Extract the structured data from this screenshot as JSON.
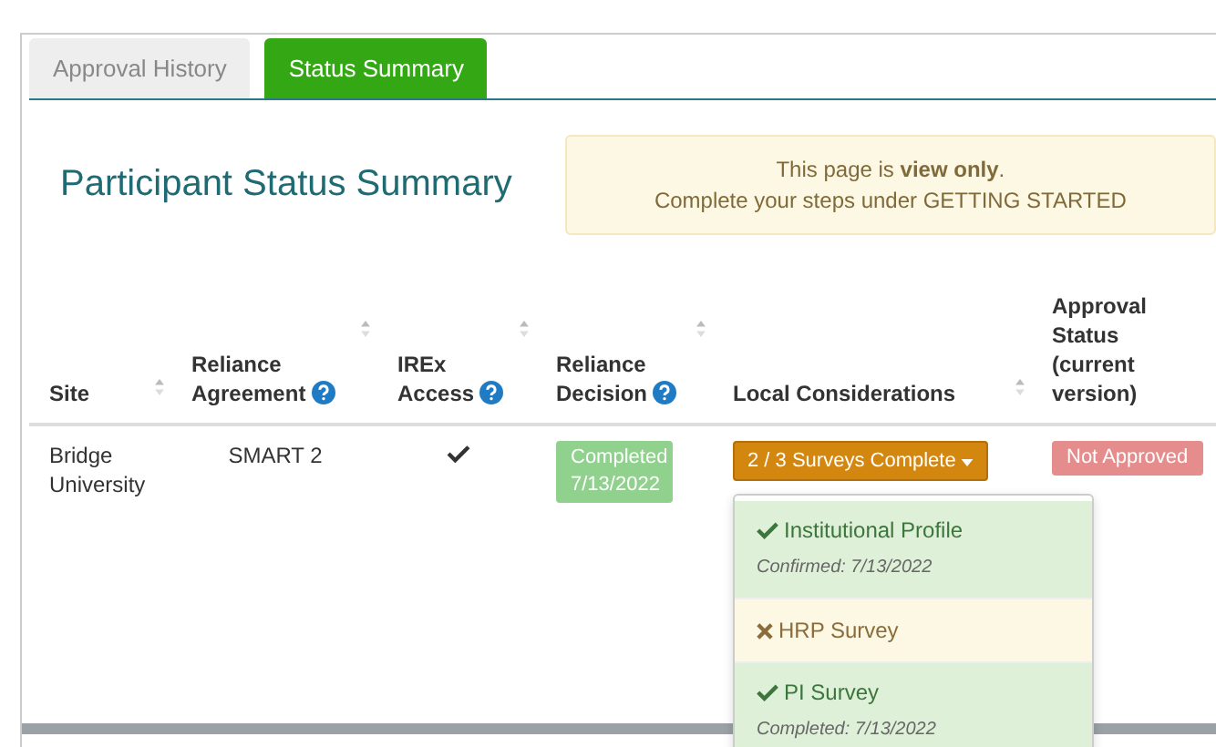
{
  "tabs": [
    {
      "label": "Approval History",
      "selected": false
    },
    {
      "label": "Status Summary",
      "selected": true
    }
  ],
  "heading": "Participant Status Summary",
  "notice": {
    "line_1": "This page is **view only**.",
    "line_2": "Complete your steps under GETTING STARTED"
  },
  "table": {
    "columns": [
      {
        "label": "Site",
        "help": false,
        "sortable": true
      },
      {
        "label": "Reliance Agreement",
        "help": true,
        "sortable": true
      },
      {
        "label": "IREx Access",
        "help": true,
        "sortable": true
      },
      {
        "label": "Reliance Decision",
        "help": true,
        "sortable": true
      },
      {
        "label": "Local Considerations",
        "help": false,
        "sortable": true
      },
      {
        "label": "Approval Status (current version)",
        "help": false,
        "sortable": false
      }
    ],
    "rows": [
      {
        "site": "Bridge University",
        "agreement": "SMART 2",
        "irex_access": true,
        "decision": "Completed 7/13/2022",
        "surveys_button": "2 / 3 Surveys Complete",
        "approval": "Not Approved"
      }
    ]
  },
  "surveys_menu": [
    {
      "title": "Institutional Profile",
      "done": true,
      "notes": [
        "Confirmed: 7/13/2022"
      ]
    },
    {
      "title": "HRP Survey",
      "done": false
    },
    {
      "title": "PI Survey",
      "done": true,
      "notes": [
        "Completed: 7/13/2022"
      ]
    }
  ]
}
